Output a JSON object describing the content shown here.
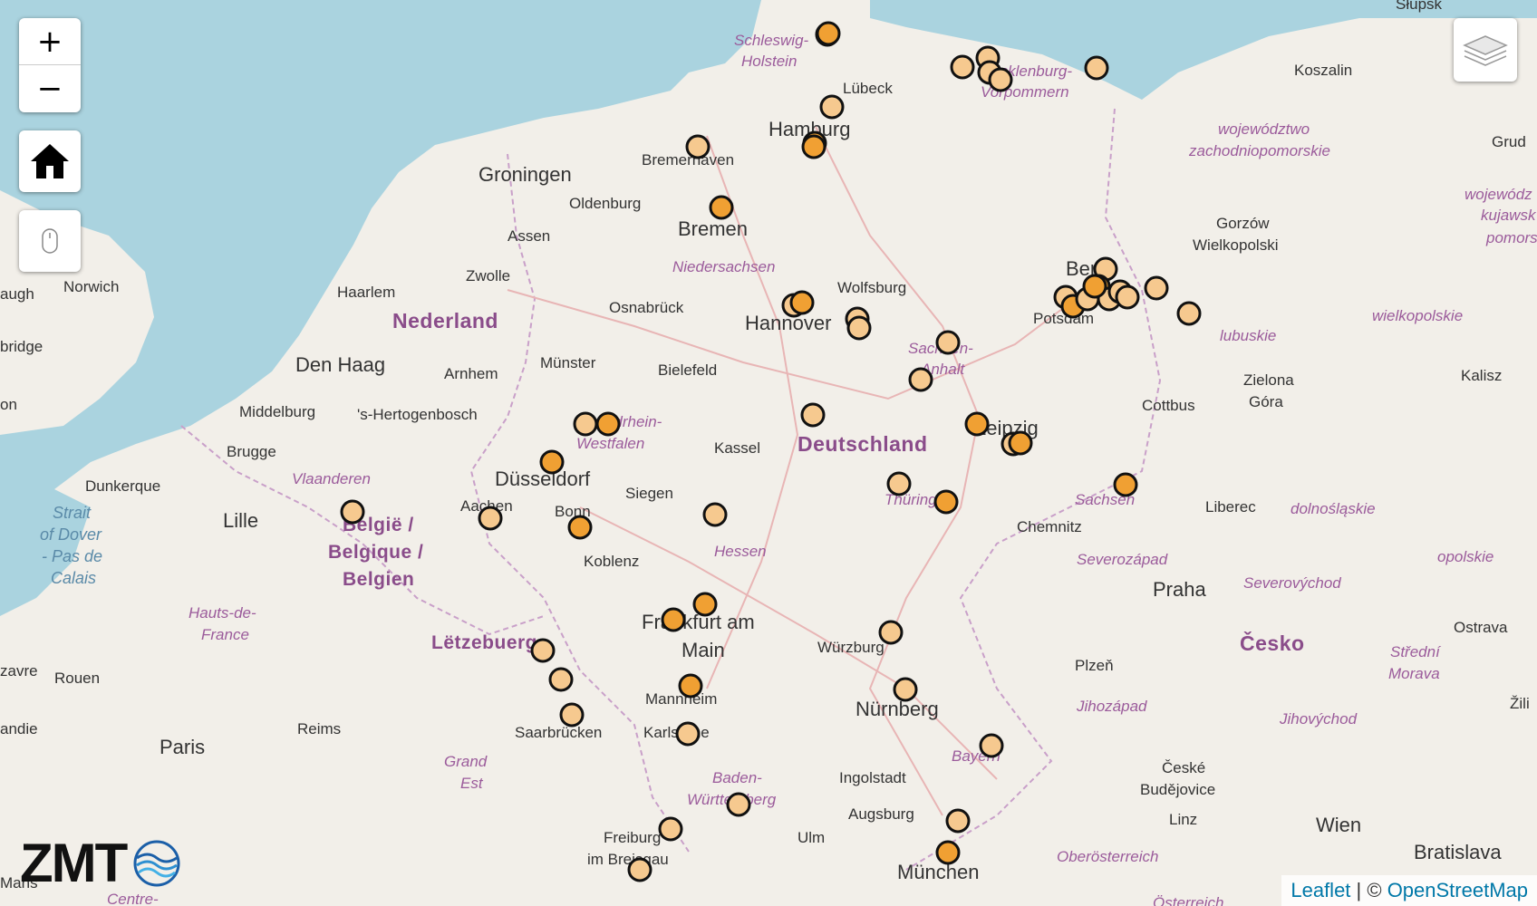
{
  "controls": {
    "zoom_in": "+",
    "zoom_out": "−"
  },
  "icons": {
    "home": "home-icon",
    "mouse": "mouse-icon",
    "layers": "layers-icon"
  },
  "logo": {
    "text": "ZMT"
  },
  "attribution": {
    "leaflet": "Leaflet",
    "separator": " | © ",
    "osm": "OpenStreetMap"
  },
  "labels": {
    "countries": [
      "Nederland",
      "Deutschland",
      "België /",
      "Belgique /",
      "Belgien",
      "Lëtzebuerg",
      "Česko"
    ],
    "cities": [
      "Hamburg",
      "Bremen",
      "Bremerhaven",
      "Lübeck",
      "Hannover",
      "Wolfsburg",
      "Berlin",
      "Potsdam",
      "Leipzig",
      "Chemnitz",
      "Kassel",
      "Düsseldorf",
      "Bonn",
      "Aachen",
      "Siegen",
      "Koblenz",
      "Frankfurt am",
      "Main",
      "Mannheim",
      "Karlsruhe",
      "Saarbrücken",
      "Würzburg",
      "Nürnberg",
      "Ingolstadt",
      "Augsburg",
      "München",
      "Ulm",
      "Freiburg",
      "im Breisgau",
      "Groningen",
      "Oldenburg",
      "Assen",
      "Zwolle",
      "Haarlem",
      "Den Haag",
      "Arnhem",
      "Osnabrück",
      "Münster",
      "Bielefeld",
      "Middelburg",
      "'s-Hertogenbosch",
      "Brugge",
      "Dunkerque",
      "Lille",
      "Rouen",
      "Reims",
      "Paris",
      "Norwich",
      "Koszalin",
      "Gorzów",
      "Wielkopolski",
      "Zielona",
      "Góra",
      "Cottbus",
      "Kalisz",
      "Liberec",
      "Praha",
      "Plzeň",
      "České",
      "Budějovice",
      "Linz",
      "Wien",
      "Bratislava",
      "Ostrava",
      "Słupsk",
      "Grud",
      "Mans",
      "augh",
      "bridge",
      "on",
      "zavre",
      "andie",
      "Žili"
    ],
    "regions": [
      "Schleswig-",
      "Holstein",
      "Mecklenburg-",
      "Vorpommern",
      "Niedersachsen",
      "Sachsen-",
      "Anhalt",
      "Nordrhein-",
      "Westfalen",
      "Thüringen",
      "Sachsen",
      "Hessen",
      "Baden-",
      "Württemberg",
      "Bayern",
      "Vlaanderen",
      "Hauts-de-",
      "France",
      "Grand",
      "Est",
      "Severozápad",
      "Severovýchod",
      "Jihozápad",
      "Jihovýchod",
      "Střední",
      "Morava",
      "Oberösterreich",
      "województwo",
      "zachodniopomorskie",
      "lubuskie",
      "wielkopolskie",
      "dolnośląskie",
      "opolskie",
      "kujawsk",
      "pomors",
      "wojewódz",
      "Strait",
      "of Dover",
      "- Pas de",
      "Calais",
      "Centre-",
      "Österreich"
    ]
  },
  "marker_style": {
    "fill_light": "#f6c98f",
    "fill_dark": "#f0a033",
    "stroke": "#111111",
    "water": "#aad3df",
    "land": "#f2efe9"
  }
}
